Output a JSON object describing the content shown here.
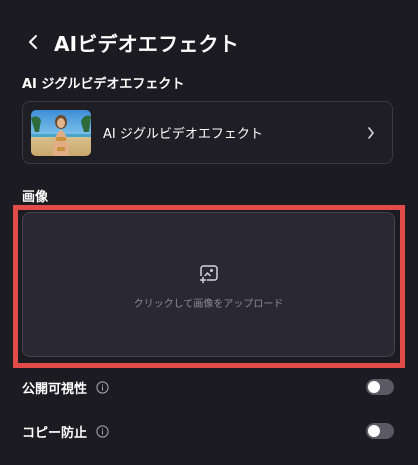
{
  "header": {
    "title": "AIビデオエフェクト",
    "back_icon": "chevron-left-icon"
  },
  "effect_section": {
    "label": "AI ジグルビデオエフェクト",
    "card": {
      "name": "AI ジグルビデオエフェクト",
      "chevron_icon": "chevron-right-icon"
    }
  },
  "image_section": {
    "label": "画像",
    "upload": {
      "icon": "image-add-icon",
      "text": "クリックして画像をアップロード"
    }
  },
  "settings": {
    "public_visibility": {
      "label": "公開可視性",
      "info_icon": "info-icon",
      "enabled": false
    },
    "copy_protection": {
      "label": "コピー防止",
      "info_icon": "info-icon",
      "enabled": false
    }
  },
  "colors": {
    "background": "#1c1b21",
    "highlight_border": "#e34b4b",
    "upload_bg": "#2a2832",
    "muted_text": "#8d8b96",
    "toggle_off": "#5b5a64"
  }
}
